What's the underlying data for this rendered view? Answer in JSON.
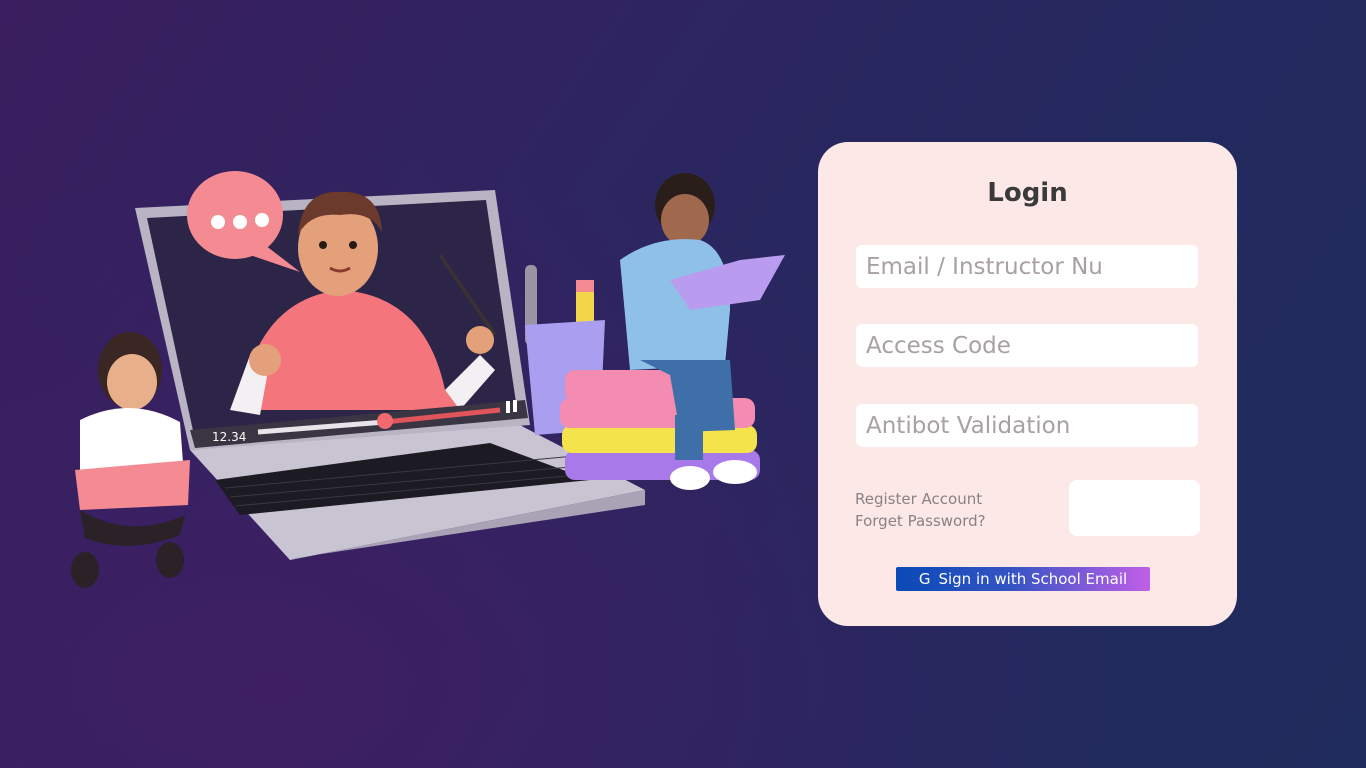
{
  "login": {
    "title": "Login",
    "email_placeholder": "Email / Instructor Nu",
    "access_code_placeholder": "Access Code",
    "antibot_placeholder": "Antibot Validation",
    "register_link": "Register Account",
    "forgot_link": "Forget Password?",
    "signin_icon": "G",
    "signin_label": "Sign in with School Email"
  },
  "illustration": {
    "video_time": "12.34",
    "icons": [
      "speech-bubble-icon",
      "pause-icon",
      "fullscreen-icon"
    ]
  },
  "colors": {
    "card_bg": "#fde8e8",
    "signin_gradient_start": "#0a49b6",
    "signin_gradient_end": "#c25fe6",
    "background_start": "#3a1d5e",
    "background_end": "#1f2b5c"
  }
}
